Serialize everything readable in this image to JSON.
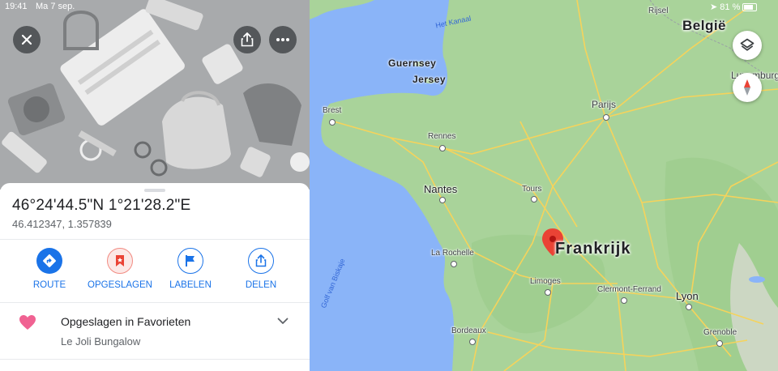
{
  "status_bar": {
    "time": "19:41",
    "date": "Ma 7 sep.",
    "battery": "81 %"
  },
  "place": {
    "coordinates_dms": "46°24'44.5\"N 1°21'28.2\"E",
    "coordinates_decimal": "46.412347, 1.357839"
  },
  "actions": [
    {
      "label": "ROUTE",
      "icon": "directions-icon"
    },
    {
      "label": "OPGESLAGEN",
      "icon": "saved-bookmark-icon"
    },
    {
      "label": "LABELEN",
      "icon": "flag-icon"
    },
    {
      "label": "DELEN",
      "icon": "share-icon"
    }
  ],
  "saved": {
    "title": "Opgeslagen in Favorieten",
    "list_name": "Le Joli Bungalow",
    "icon": "heart-icon"
  },
  "map": {
    "sea_label": "Het Kanaal",
    "bay_label": "Golf van Biskaje",
    "islands": [
      "Guernsey",
      "Jersey"
    ],
    "countries": [
      "Frankrijk",
      "België",
      "Luxemburg"
    ],
    "cities": {
      "paris": "Parijs",
      "brest": "Brest",
      "rennes": "Rennes",
      "nantes": "Nantes",
      "tours": "Tours",
      "la_rochelle": "La Rochelle",
      "limoges": "Limoges",
      "clermont": "Clermont-Ferrand",
      "lyon": "Lyon",
      "bordeaux": "Bordeaux",
      "grenoble": "Grenoble",
      "rijsel": "Rijsel"
    },
    "colors": {
      "water": "#8ab4f8",
      "land": "#a9d39a",
      "roads": "#f6d35b",
      "pin": "#ea4335"
    }
  }
}
